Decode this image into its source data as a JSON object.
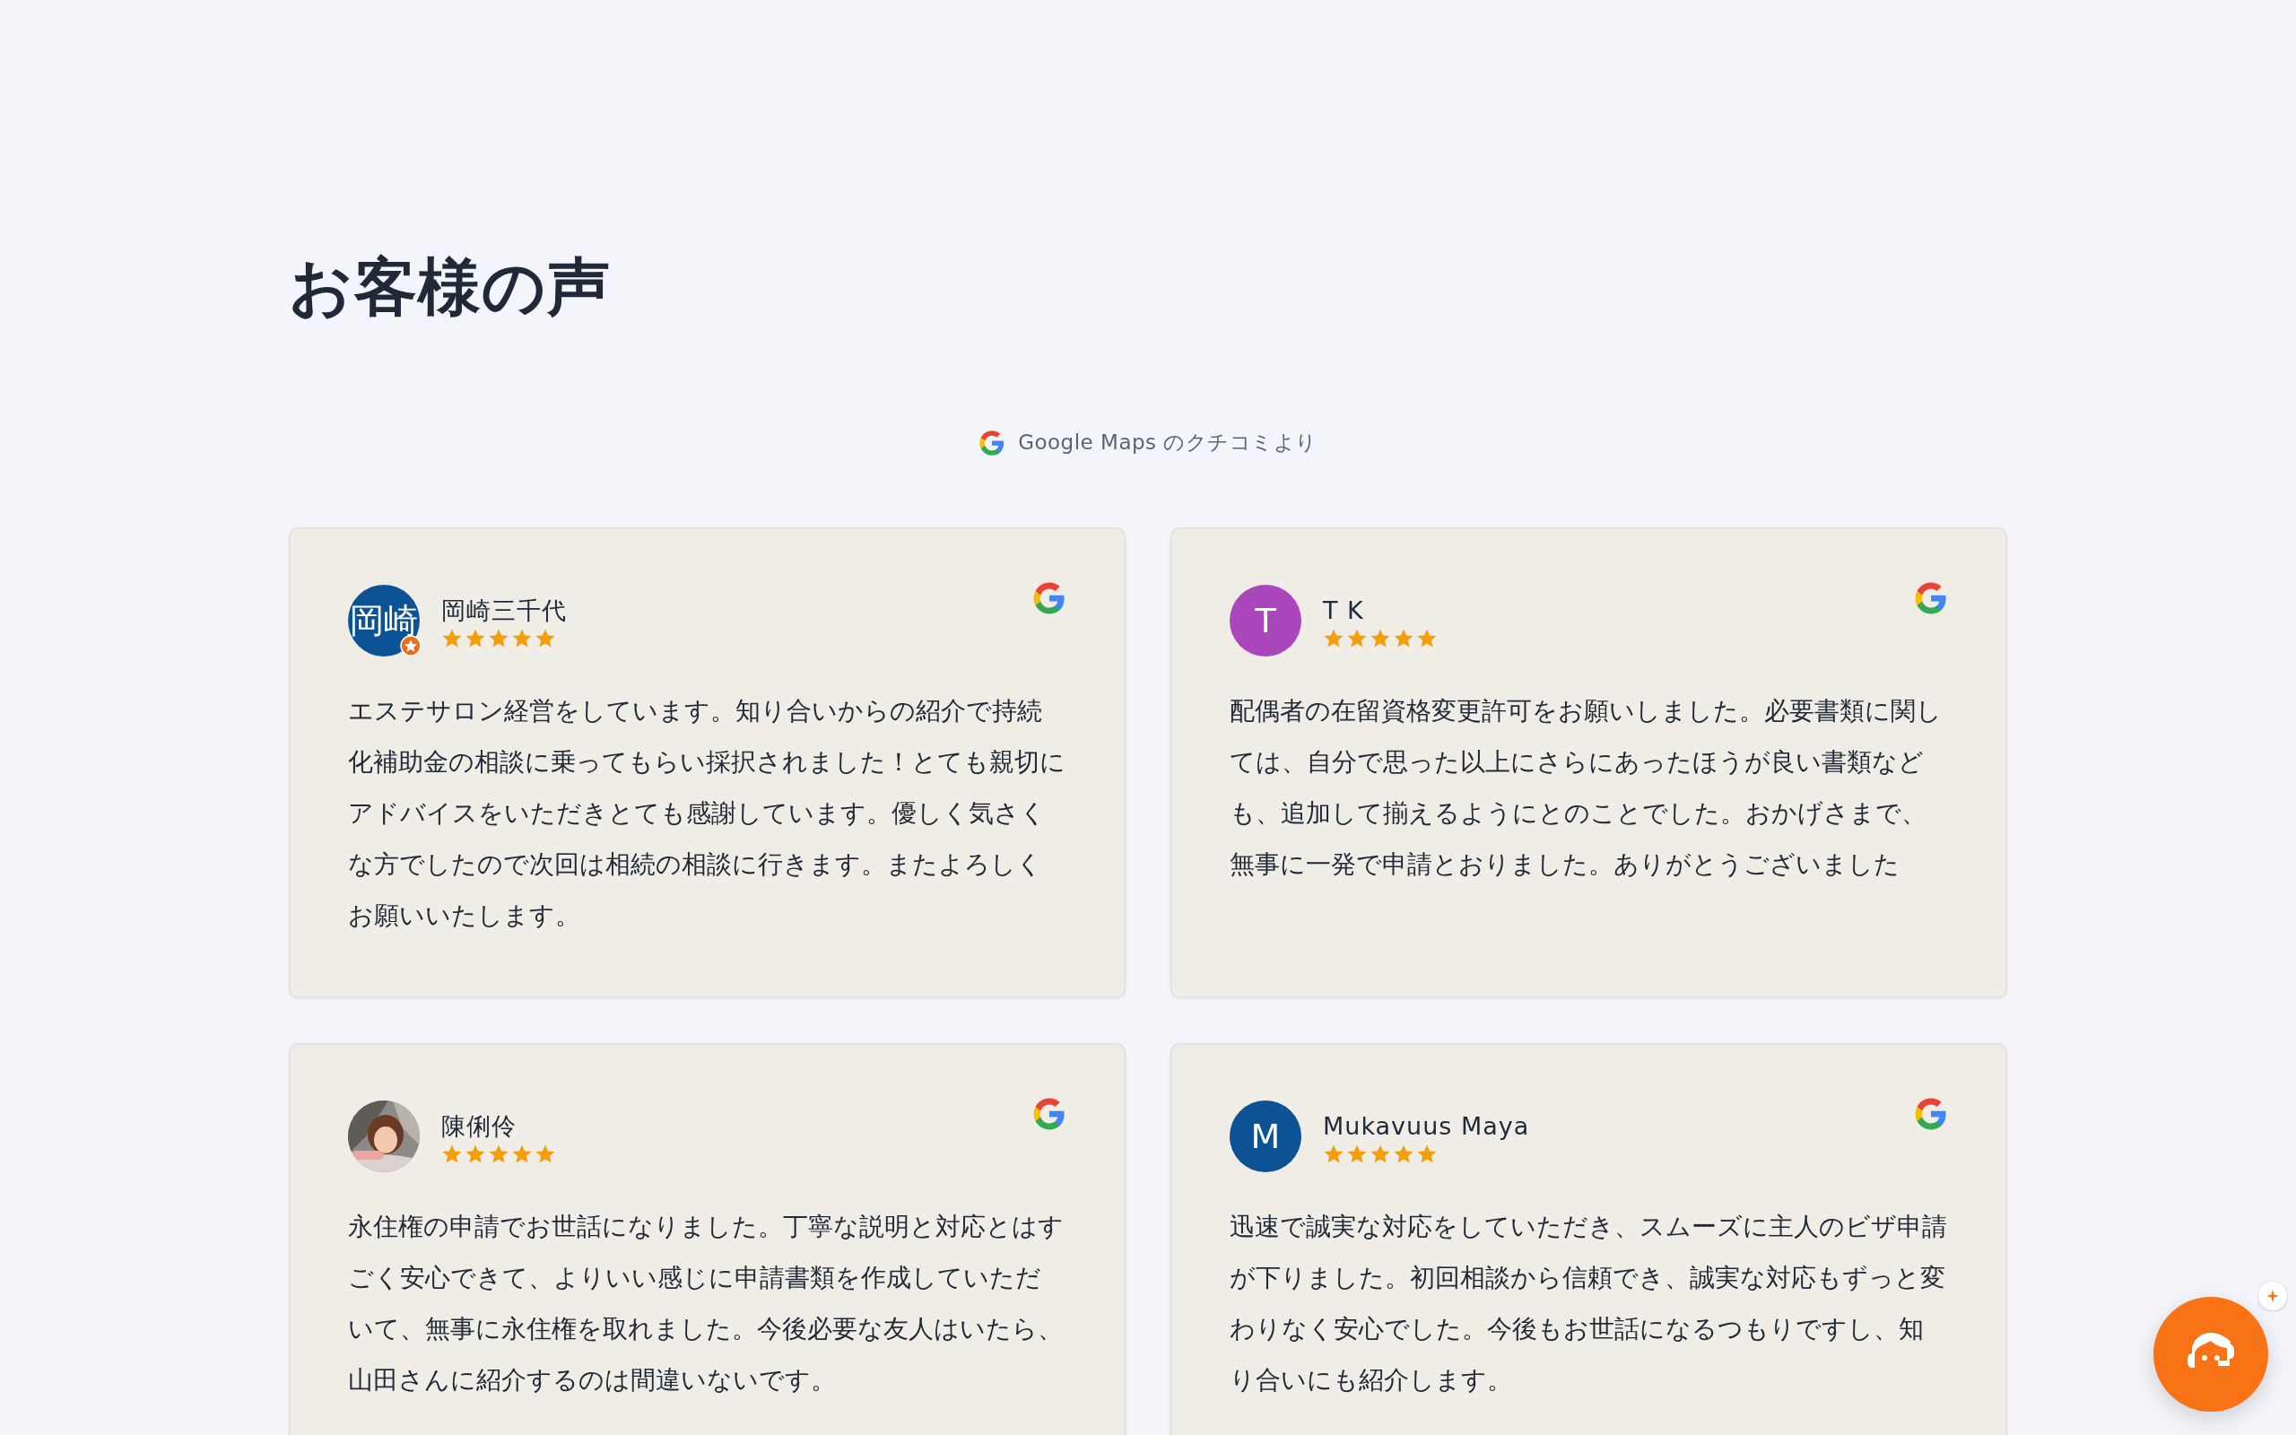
{
  "heading": "お客様の声",
  "source_note": "Google Maps のクチコミより",
  "reviews": [
    {
      "name": "岡崎三千代",
      "avatar": {
        "kind": "initials",
        "text": "岡崎",
        "color": "#0b5394",
        "badge": true
      },
      "stars": 5,
      "text": "エステサロン経営をしています。知り合いからの紹介で持続化補助金の相談に乗ってもらい採択されました！とても親切にアドバイスをいただきとても感謝しています。優しく気さくな方でしたので次回は相続の相談に行きます。またよろしくお願いいたします。"
    },
    {
      "name": "T K",
      "avatar": {
        "kind": "initials",
        "text": "T",
        "color": "#ab47bc",
        "badge": false
      },
      "stars": 5,
      "text": "配偶者の在留資格変更許可をお願いしました。必要書類に関しては、自分で思った以上にさらにあったほうが良い書類なども、追加して揃えるようにとのことでした。おかげさまで、無事に一発で申請とおりました。ありがとうございました"
    },
    {
      "name": "陳俐伶",
      "stars": 5,
      "text": "永住権の申請でお世話になりました。丁寧な説明と対応とはすごく安心できて、よりいい感じに申請書類を作成していただいて、無事に永住権を取れました。今後必要な友人はいたら、山田さんに紹介するのは間違いないです。"
    },
    {
      "name": "Mukavuus Maya",
      "avatar": {
        "kind": "initials",
        "text": "M",
        "color": "#0b5394",
        "badge": false
      },
      "stars": 5,
      "text": "迅速で誠実な対応をしていただき、スムーズに主人のビザ申請が下りました。初回相談から信頼でき、誠実な対応もずっと変わりなく安心でした。今後もお世話になるつもりですし、知り合いにも紹介します。"
    }
  ],
  "chat_button": {
    "badge": true
  }
}
